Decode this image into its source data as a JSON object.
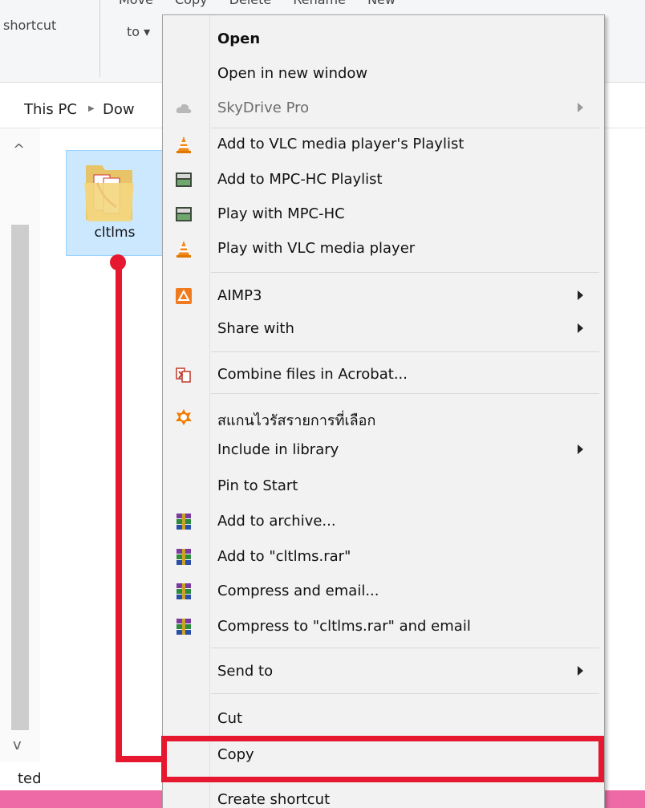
{
  "ribbon": {
    "tabs": [
      "Move",
      "Copy",
      "Delete",
      "Rename",
      "New"
    ],
    "shortcut_label": "shortcut",
    "move_to_label": "to ▾"
  },
  "address": {
    "crumb1": "This PC",
    "crumb2": "Dow"
  },
  "folder": {
    "name": "cltlms"
  },
  "status": {
    "text": "ted"
  },
  "menu": {
    "items": [
      {
        "label": "Open",
        "icon": "none",
        "submenu": false,
        "bold": true
      },
      {
        "label": "Open in new window",
        "icon": "none",
        "submenu": false
      },
      {
        "label": "SkyDrive Pro",
        "icon": "cloud-icon",
        "submenu": true,
        "disabled": true
      },
      {
        "label": "Add to VLC media player's Playlist",
        "icon": "vlc-cone-icon",
        "submenu": false
      },
      {
        "label": "Add to MPC-HC Playlist",
        "icon": "mpc-hc-icon",
        "submenu": false
      },
      {
        "label": "Play with MPC-HC",
        "icon": "mpc-hc-icon",
        "submenu": false
      },
      {
        "label": "Play with VLC media player",
        "icon": "vlc-cone-icon",
        "submenu": false
      },
      {
        "label": "AIMP3",
        "icon": "aimp-icon",
        "submenu": true
      },
      {
        "label": "Share with",
        "icon": "none",
        "submenu": true
      },
      {
        "label": "Combine files in Acrobat...",
        "icon": "acrobat-combine-icon",
        "submenu": false
      },
      {
        "label": "สแกนไวรัสรายการที่เลือก",
        "icon": "avast-icon",
        "submenu": false
      },
      {
        "label": "Include in library",
        "icon": "none",
        "submenu": true
      },
      {
        "label": "Pin to Start",
        "icon": "none",
        "submenu": false
      },
      {
        "label": "Add to archive...",
        "icon": "winrar-icon",
        "submenu": false
      },
      {
        "label": "Add to \"cltlms.rar\"",
        "icon": "winrar-icon",
        "submenu": false
      },
      {
        "label": "Compress and email...",
        "icon": "winrar-icon",
        "submenu": false
      },
      {
        "label": "Compress to \"cltlms.rar\" and email",
        "icon": "winrar-icon",
        "submenu": false
      },
      {
        "label": "Send to",
        "icon": "none",
        "submenu": true
      },
      {
        "label": "Cut",
        "icon": "none",
        "submenu": false
      },
      {
        "label": "Copy",
        "icon": "none",
        "submenu": false
      },
      {
        "label": "Create shortcut",
        "icon": "none",
        "submenu": false
      }
    ]
  },
  "colors": {
    "annotation": "#e5182f",
    "selection": "#cce8ff",
    "pink_bar": "#ee6aa7"
  }
}
